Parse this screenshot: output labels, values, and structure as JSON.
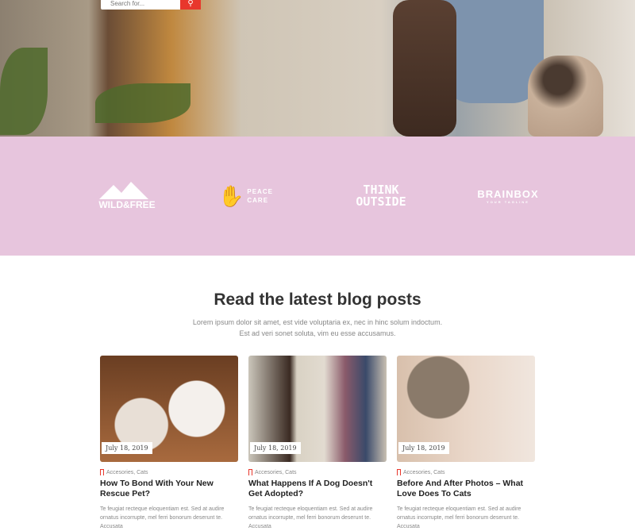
{
  "search": {
    "placeholder": "Search for...",
    "icon": "search-icon",
    "accent": "#e8372c"
  },
  "partners": {
    "background": "#e7c5dd",
    "logos": [
      {
        "line1": "WILD&FREE"
      },
      {
        "line1": "PEACE",
        "line2": "CARE"
      },
      {
        "line1": "THINK",
        "line2": "OUTSIDE"
      },
      {
        "line1": "BRAINBOX",
        "line2": "YOUR TAGLINE"
      }
    ]
  },
  "blog": {
    "title": "Read the latest blog posts",
    "subtitle": "Lorem ipsum dolor sit amet, est vide voluptaria ex, nec in hinc solum indoctum. Est ad veri sonet soluta, vim eu esse accusamus.",
    "posts": [
      {
        "date": "July 18, 2019",
        "categories": "Accesories, Cats",
        "title": "How To Bond With Your New Rescue Pet?",
        "excerpt": "Te feugiat recteque eloquentiam est. Sed at audire ornatus incorrupte, mel ferri bonorum deserunt te. Accusata"
      },
      {
        "date": "July 18, 2019",
        "categories": "Accesories, Cats",
        "title": "What Happens If A Dog Doesn't Get Adopted?",
        "excerpt": "Te feugiat recteque eloquentiam est. Sed at audire ornatus incorrupte, mel ferri bonorum deserunt te. Accusata"
      },
      {
        "date": "July 18, 2019",
        "categories": "Accesories, Cats",
        "title": "Before And After Photos – What Love Does To Cats",
        "excerpt": "Te feugiat recteque eloquentiam est. Sed at audire ornatus incorrupte, mel ferri bonorum deserunt te. Accusata"
      }
    ]
  }
}
